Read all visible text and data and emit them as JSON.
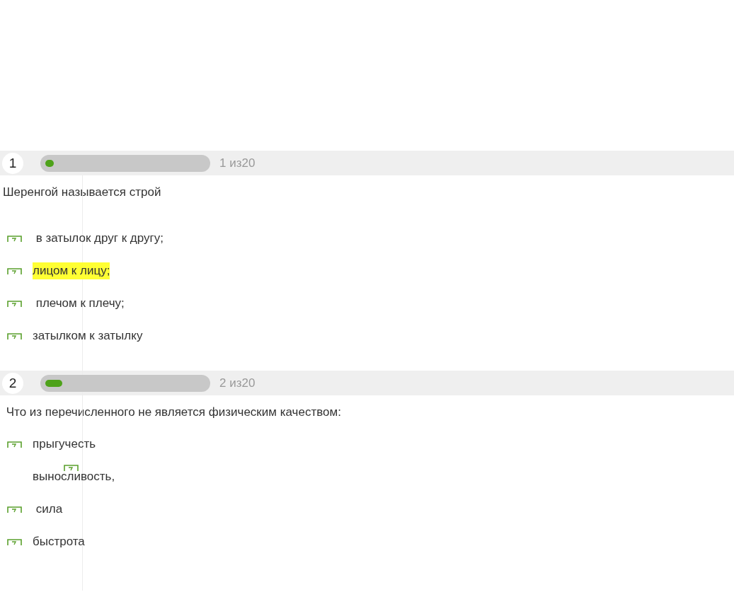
{
  "questions": [
    {
      "number": "1",
      "level": 0.05,
      "counter": "1 из20",
      "text": "Шеренгой называется строй",
      "answers": [
        {
          "text": " в затылок друг к другу;",
          "highlighted": false,
          "kind": "standard"
        },
        {
          "text": "лицом к лицу;",
          "highlighted": true,
          "kind": "standard"
        },
        {
          "text": " плечом к плечу;",
          "highlighted": false,
          "kind": "standard"
        },
        {
          "text": "затылком к затылку",
          "highlighted": false,
          "kind": "standard"
        }
      ]
    },
    {
      "number": "2",
      "level": 0.1,
      "counter": "2 из20",
      "text": " Что из перечисленного не является физическим качеством:",
      "answers": [
        {
          "text": "прыгучесть",
          "highlighted": false,
          "kind": "standard"
        },
        {
          "text": "выносливость,",
          "highlighted": false,
          "kind": "misplaced"
        },
        {
          "text": " сила",
          "highlighted": false,
          "kind": "standard"
        },
        {
          "text": "быстрота",
          "highlighted": false,
          "kind": "standard"
        }
      ]
    }
  ]
}
